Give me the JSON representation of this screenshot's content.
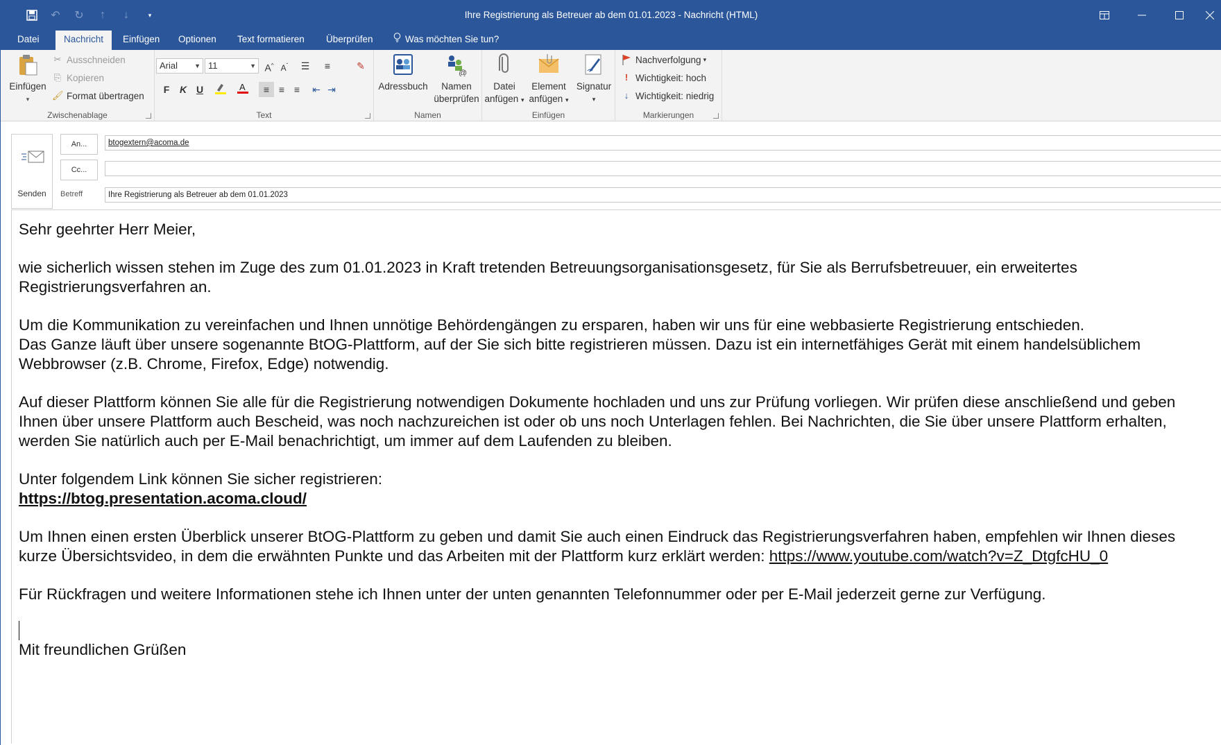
{
  "window": {
    "title": "Ihre Registrierung als Betreuer ab dem 01.01.2023  - Nachricht (HTML)"
  },
  "tabs": [
    {
      "label": "Datei"
    },
    {
      "label": "Nachricht"
    },
    {
      "label": "Einfügen"
    },
    {
      "label": "Optionen"
    },
    {
      "label": "Text formatieren"
    },
    {
      "label": "Überprüfen"
    }
  ],
  "tell_me": "Was möchten Sie tun?",
  "ribbon": {
    "clipboard": {
      "paste": "Einfügen",
      "cut": "Ausschneiden",
      "copy": "Kopieren",
      "format_painter": "Format übertragen",
      "group_label": "Zwischenablage"
    },
    "text": {
      "font": "Arial",
      "size": "11",
      "bold": "F",
      "italic": "K",
      "underline": "U",
      "group_label": "Text"
    },
    "names": {
      "address_book": "Adressbuch",
      "check_names_1": "Namen",
      "check_names_2": "überprüfen",
      "group_label": "Namen"
    },
    "insert": {
      "attach_file_1": "Datei",
      "attach_file_2": "anfügen",
      "attach_item_1": "Element",
      "attach_item_2": "anfügen",
      "signature": "Signatur",
      "group_label": "Einfügen"
    },
    "tags": {
      "follow_up": "Nachverfolgung",
      "high_importance": "Wichtigkeit: hoch",
      "low_importance": "Wichtigkeit: niedrig",
      "group_label": "Markierungen"
    }
  },
  "compose": {
    "send": "Senden",
    "to_button": "An...",
    "cc_button": "Cc...",
    "to_value": "btogextern@acoma.de",
    "cc_value": "",
    "subject_label": "Betreff",
    "subject_value": "Ihre Registrierung als Betreuer ab dem 01.01.2023"
  },
  "body": {
    "greeting": "Sehr geehrter Herr Meier,",
    "p1": "wie sicherlich wissen stehen im Zuge des zum 01.01.2023 in Kraft tretenden Betreuungsorganisationsgesetz, für Sie als Berrufsbetreuuer, ein erweitertes Registrierungsverfahren an.",
    "p2a": "Um die Kommunikation zu vereinfachen und Ihnen unnötige Behördengängen zu ersparen, haben wir uns für eine webbasierte Registrierung entschieden.",
    "p2b": "Das Ganze läuft über unsere sogenannte BtOG-Plattform, auf der Sie sich bitte registrieren müssen. Dazu ist ein internetfähiges Gerät mit einem handelsüblichem Webbrowser (z.B. Chrome, Firefox, Edge) notwendig.",
    "p3": "Auf dieser Plattform können Sie alle für die Registrierung notwendigen Dokumente hochladen und uns zur Prüfung vorliegen. Wir prüfen diese anschließend und geben Ihnen über unsere Plattform auch Bescheid, was noch nachzureichen ist oder ob uns noch Unterlagen fehlen. Bei Nachrichten, die Sie über unsere Plattform erhalten, werden Sie natürlich auch per E-Mail benachrichtigt, um immer auf dem Laufenden zu bleiben.",
    "p4": "Unter folgendem Link können Sie sicher registrieren:",
    "platform_link": "https://btog.presentation.acoma.cloud/",
    "p5": "Um Ihnen einen ersten Überblick unserer BtOG-Plattform zu geben und damit Sie auch einen Eindruck das Registrierungsverfahren haben, empfehlen wir Ihnen dieses kurze Übersichtsvideo, in dem die erwähnten Punkte und das Arbeiten mit der Plattform kurz erklärt werden: ",
    "video_link": "https://www.youtube.com/watch?v=Z_DtgfcHU_0",
    "p6": "Für Rückfragen und weitere Informationen stehe ich Ihnen unter der unten genannten Telefonnummer oder per E-Mail jederzeit gerne zur Verfügung.",
    "closing": "Mit freundlichen Grüßen"
  },
  "colors": {
    "accent": "#2b579a",
    "ribbon_bg": "#f3f3f3"
  }
}
